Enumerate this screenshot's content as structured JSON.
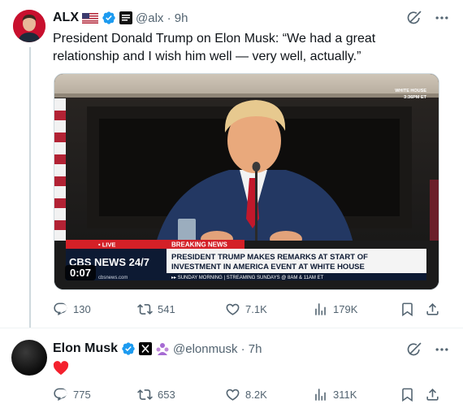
{
  "tweets": [
    {
      "author_name": "ALX",
      "handle_time": "@alx · 9h",
      "text": "President Donald Trump on Elon Musk: “We had a great relationship and I wish him well — very well, actually.”",
      "video": {
        "duration": "0:07",
        "network": "CBS NEWS 24/7",
        "live_label": "• LIVE",
        "breaking_label": "BREAKING NEWS",
        "headline_line1": "PRESIDENT TRUMP MAKES REMARKS AT START OF",
        "headline_line2": "INVESTMENT IN AMERICA EVENT AT WHITE HOUSE",
        "ticker": "▸▸ SUNDAY MORNING | STREAMING SUNDAYS @ 8AM & 11AM ET",
        "location_line1": "WHITE HOUSE",
        "location_line2": "3:36PM ET",
        "site": "cbsnews.com"
      },
      "stats": {
        "replies": "130",
        "reposts": "541",
        "likes": "7.1K",
        "views": "179K"
      }
    },
    {
      "author_name": "Elon Musk",
      "handle_time": "@elonmusk · 7h",
      "text_emoji": "heart",
      "stats": {
        "replies": "775",
        "reposts": "653",
        "likes": "8.2K",
        "views": "311K"
      }
    }
  ],
  "colors": {
    "verified_blue": "#1d9bf0",
    "heart_red": "#f4212e",
    "secondary_text": "#536471"
  },
  "icons": [
    "grok-icon",
    "more-icon",
    "reply-icon",
    "repost-icon",
    "like-icon",
    "views-icon",
    "bookmark-icon",
    "share-icon"
  ]
}
